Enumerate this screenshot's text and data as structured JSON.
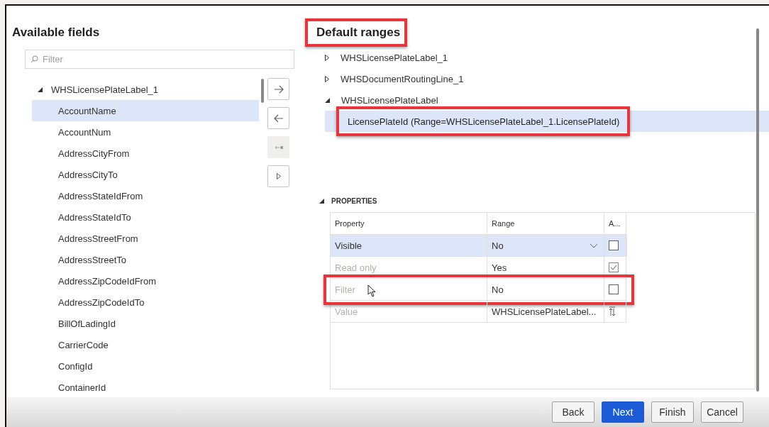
{
  "available_fields": {
    "title": "Available fields",
    "filter": {
      "placeholder": "Filter"
    },
    "tree": {
      "label": "WHSLicensePlateLabel_1",
      "expanded": true,
      "children": [
        {
          "label": "AccountName",
          "selected": true
        },
        {
          "label": "AccountNum",
          "selected": false
        },
        {
          "label": "AddressCityFrom",
          "selected": false
        },
        {
          "label": "AddressCityTo",
          "selected": false
        },
        {
          "label": "AddressStateIdFrom",
          "selected": false
        },
        {
          "label": "AddressStateIdTo",
          "selected": false
        },
        {
          "label": "AddressStreetFrom",
          "selected": false
        },
        {
          "label": "AddressStreetTo",
          "selected": false
        },
        {
          "label": "AddressZipCodeIdFrom",
          "selected": false
        },
        {
          "label": "AddressZipCodeIdTo",
          "selected": false
        },
        {
          "label": "BillOfLadingId",
          "selected": false
        },
        {
          "label": "CarrierCode",
          "selected": false
        },
        {
          "label": "ConfigId",
          "selected": false
        },
        {
          "label": "ContainerId",
          "selected": false
        }
      ]
    }
  },
  "transfer_buttons": [
    {
      "kind": "add",
      "disabled": false
    },
    {
      "kind": "remove",
      "disabled": false
    },
    {
      "kind": "remove_all",
      "disabled": true
    },
    {
      "kind": "expand",
      "disabled": false
    }
  ],
  "default_ranges": {
    "title": "Default ranges",
    "highlighted": true,
    "tree": [
      {
        "label": "WHSLicensePlateLabel_1",
        "expanded": false
      },
      {
        "label": "WHSDocumentRoutingLine_1",
        "expanded": false
      },
      {
        "label": "WHSLicensePlateLabel",
        "expanded": true,
        "children": [
          {
            "label": "LicensePlateId (Range=WHSLicensePlateLabel_1.LicensePlateId)",
            "selected": true,
            "highlighted": true
          }
        ]
      }
    ]
  },
  "properties": {
    "title": "PROPERTIES",
    "expanded": true,
    "columns": [
      "Property",
      "Range",
      "A..."
    ],
    "rows": [
      {
        "property": "Visible",
        "range": "No",
        "kind": "checkbox",
        "dropdown": true,
        "checked": false,
        "disabled": false,
        "selected": true,
        "highlighted": false
      },
      {
        "property": "Read only",
        "range": "Yes",
        "kind": "checkbox",
        "dropdown": false,
        "checked": true,
        "disabled": true,
        "selected": false,
        "highlighted": false
      },
      {
        "property": "Filter",
        "range": "No",
        "kind": "checkbox",
        "dropdown": false,
        "checked": false,
        "disabled": true,
        "selected": false,
        "highlighted": true
      },
      {
        "property": "Value",
        "range": "WHSLicensePlateLabel...",
        "kind": "lookup",
        "dropdown": false,
        "disabled": true,
        "selected": false,
        "highlighted": false
      }
    ]
  },
  "buttons": [
    {
      "label": "Back",
      "primary": false
    },
    {
      "label": "Next",
      "primary": true
    },
    {
      "label": "Finish",
      "primary": false
    },
    {
      "label": "Cancel",
      "primary": false
    }
  ]
}
